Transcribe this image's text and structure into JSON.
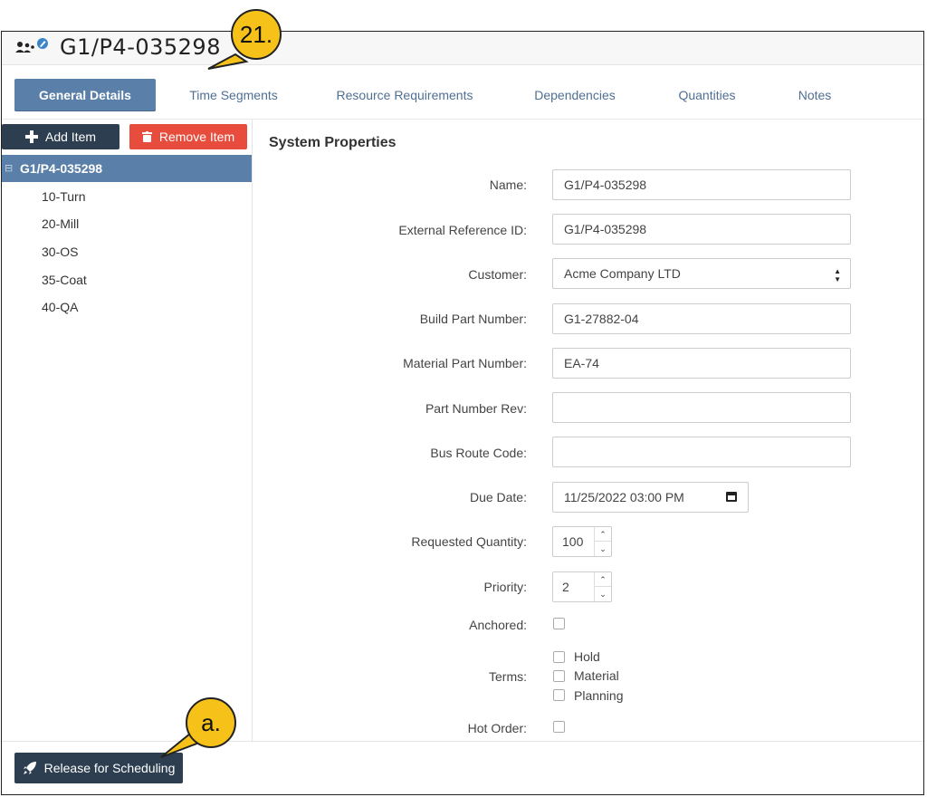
{
  "window": {
    "title": "G1/P4-035298"
  },
  "tabs": [
    {
      "label": "General Details",
      "active": true
    },
    {
      "label": "Time Segments"
    },
    {
      "label": "Resource Requirements"
    },
    {
      "label": "Dependencies"
    },
    {
      "label": "Quantities"
    },
    {
      "label": "Notes"
    }
  ],
  "toolbar": {
    "add_label": "Add Item",
    "remove_label": "Remove Item"
  },
  "tree": {
    "root": "G1/P4-035298",
    "root_expander": "⊟",
    "children": [
      "10-Turn",
      "20-Mill",
      "30-OS",
      "35-Coat",
      "40-QA"
    ]
  },
  "section": {
    "title": "System Properties"
  },
  "fields": {
    "name": {
      "label": "Name:",
      "value": "G1/P4-035298"
    },
    "external_ref": {
      "label": "External Reference ID:",
      "value": "G1/P4-035298"
    },
    "customer": {
      "label": "Customer:",
      "value": "Acme Company LTD"
    },
    "build_part": {
      "label": "Build Part Number:",
      "value": "G1-27882-04"
    },
    "material_part": {
      "label": "Material Part Number:",
      "value": "EA-74"
    },
    "part_rev": {
      "label": "Part Number Rev:",
      "value": ""
    },
    "bus_route": {
      "label": "Bus Route Code:",
      "value": ""
    },
    "due_date": {
      "label": "Due Date:",
      "value": "11/25/2022 03:00 PM"
    },
    "requested_qty": {
      "label": "Requested Quantity:",
      "value": "100"
    },
    "priority": {
      "label": "Priority:",
      "value": "2"
    },
    "anchored": {
      "label": "Anchored:",
      "checked": false
    },
    "terms": {
      "label": "Terms:",
      "options": [
        {
          "label": "Hold",
          "checked": false
        },
        {
          "label": "Material",
          "checked": false
        },
        {
          "label": "Planning",
          "checked": false
        }
      ]
    },
    "hot_order": {
      "label": "Hot Order:",
      "checked": false
    }
  },
  "footer": {
    "release_label": "Release for Scheduling"
  },
  "callouts": {
    "step": "21.",
    "sub": "a."
  },
  "colors": {
    "primary": "#5a7fa8",
    "dark": "#2c3e50",
    "danger": "#e74c3c",
    "callout": "#f6c21a"
  }
}
